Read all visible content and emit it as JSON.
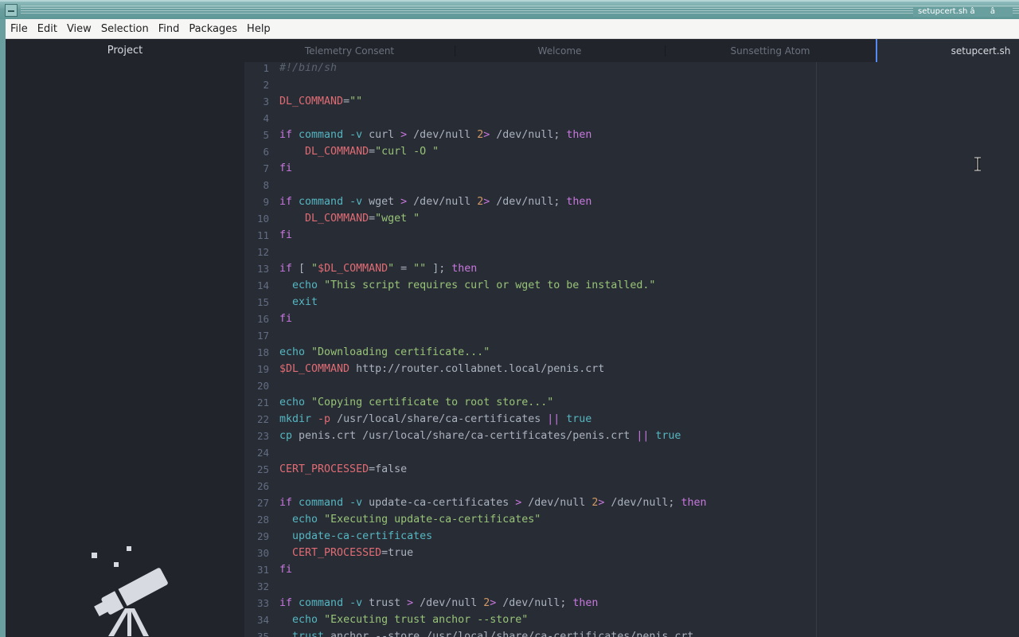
{
  "window": {
    "title": "setupcert.sh â â"
  },
  "menubar": [
    "File",
    "Edit",
    "View",
    "Selection",
    "Find",
    "Packages",
    "Help"
  ],
  "tree_view": {
    "header": "Project"
  },
  "tabs": [
    {
      "label": "Telemetry Consent",
      "active": false
    },
    {
      "label": "Welcome",
      "active": false
    },
    {
      "label": "Sunsetting Atom",
      "active": false
    },
    {
      "label": "setupcert.sh",
      "active": true
    }
  ],
  "editor": {
    "syntax_colors": {
      "comment": "#5c6370",
      "variable": "#e06c75",
      "string": "#98c379",
      "keyword": "#c678dd",
      "builtin": "#56b6c2",
      "constant": "#d19a66"
    },
    "lines": [
      [
        [
          "c-cmt",
          "#!/bin/sh"
        ]
      ],
      [],
      [
        [
          "c-var",
          "DL_COMMAND"
        ],
        [
          "",
          "="
        ],
        [
          "c-str",
          "\"\""
        ]
      ],
      [],
      [
        [
          "c-kw",
          "if"
        ],
        [
          "",
          " "
        ],
        [
          "c-fn",
          "command"
        ],
        [
          "",
          " "
        ],
        [
          "c-fn",
          "-v"
        ],
        [
          "",
          " curl "
        ],
        [
          "c-kw",
          ">"
        ],
        [
          "",
          " /dev/null "
        ],
        [
          "c-num",
          "2"
        ],
        [
          "c-kw",
          ">"
        ],
        [
          "",
          " /dev/null; "
        ],
        [
          "c-kw",
          "then"
        ]
      ],
      [
        [
          "",
          "    "
        ],
        [
          "c-var",
          "DL_COMMAND"
        ],
        [
          "",
          "="
        ],
        [
          "c-str",
          "\"curl -O \""
        ]
      ],
      [
        [
          "c-kw",
          "fi"
        ]
      ],
      [],
      [
        [
          "c-kw",
          "if"
        ],
        [
          "",
          " "
        ],
        [
          "c-fn",
          "command"
        ],
        [
          "",
          " "
        ],
        [
          "c-fn",
          "-v"
        ],
        [
          "",
          " wget "
        ],
        [
          "c-kw",
          ">"
        ],
        [
          "",
          " /dev/null "
        ],
        [
          "c-num",
          "2"
        ],
        [
          "c-kw",
          ">"
        ],
        [
          "",
          " /dev/null; "
        ],
        [
          "c-kw",
          "then"
        ]
      ],
      [
        [
          "",
          "    "
        ],
        [
          "c-var",
          "DL_COMMAND"
        ],
        [
          "",
          "="
        ],
        [
          "c-str",
          "\"wget \""
        ]
      ],
      [
        [
          "c-kw",
          "fi"
        ]
      ],
      [],
      [
        [
          "c-kw",
          "if"
        ],
        [
          "",
          " [ "
        ],
        [
          "c-str",
          "\""
        ],
        [
          "c-var",
          "$DL_COMMAND"
        ],
        [
          "c-str",
          "\""
        ],
        [
          "",
          " = "
        ],
        [
          "c-str",
          "\"\""
        ],
        [
          "",
          " ]; "
        ],
        [
          "c-kw",
          "then"
        ]
      ],
      [
        [
          "",
          "  "
        ],
        [
          "c-fn",
          "echo"
        ],
        [
          "",
          " "
        ],
        [
          "c-str",
          "\"This script requires curl or wget to be installed.\""
        ]
      ],
      [
        [
          "",
          "  "
        ],
        [
          "c-fn",
          "exit"
        ]
      ],
      [
        [
          "c-kw",
          "fi"
        ]
      ],
      [],
      [
        [
          "c-fn",
          "echo"
        ],
        [
          "",
          " "
        ],
        [
          "c-str",
          "\"Downloading certificate...\""
        ]
      ],
      [
        [
          "c-var",
          "$DL_COMMAND"
        ],
        [
          "",
          " http://router.collabnet.local/penis.crt"
        ]
      ],
      [],
      [
        [
          "c-fn",
          "echo"
        ],
        [
          "",
          " "
        ],
        [
          "c-str",
          "\"Copying certificate to root store...\""
        ]
      ],
      [
        [
          "c-fn",
          "mkdir"
        ],
        [
          "",
          " "
        ],
        [
          "c-var",
          "-p"
        ],
        [
          "",
          " /usr/local/share/ca-certificates "
        ],
        [
          "c-kw",
          "||"
        ],
        [
          "",
          " "
        ],
        [
          "c-fn",
          "true"
        ]
      ],
      [
        [
          "c-fn",
          "cp"
        ],
        [
          "",
          " penis.crt /usr/local/share/ca-certificates/penis.crt "
        ],
        [
          "c-kw",
          "||"
        ],
        [
          "",
          " "
        ],
        [
          "c-fn",
          "true"
        ]
      ],
      [],
      [
        [
          "c-var",
          "CERT_PROCESSED"
        ],
        [
          "",
          "=false"
        ]
      ],
      [],
      [
        [
          "c-kw",
          "if"
        ],
        [
          "",
          " "
        ],
        [
          "c-fn",
          "command"
        ],
        [
          "",
          " "
        ],
        [
          "c-fn",
          "-v"
        ],
        [
          "",
          " update-ca-certificates "
        ],
        [
          "c-kw",
          ">"
        ],
        [
          "",
          " /dev/null "
        ],
        [
          "c-num",
          "2"
        ],
        [
          "c-kw",
          ">"
        ],
        [
          "",
          " /dev/null; "
        ],
        [
          "c-kw",
          "then"
        ]
      ],
      [
        [
          "",
          "  "
        ],
        [
          "c-fn",
          "echo"
        ],
        [
          "",
          " "
        ],
        [
          "c-str",
          "\"Executing update-ca-certificates\""
        ]
      ],
      [
        [
          "",
          "  "
        ],
        [
          "c-fn",
          "update-ca-certificates"
        ]
      ],
      [
        [
          "",
          "  "
        ],
        [
          "c-var",
          "CERT_PROCESSED"
        ],
        [
          "",
          "=true"
        ]
      ],
      [
        [
          "c-kw",
          "fi"
        ]
      ],
      [],
      [
        [
          "c-kw",
          "if"
        ],
        [
          "",
          " "
        ],
        [
          "c-fn",
          "command"
        ],
        [
          "",
          " "
        ],
        [
          "c-fn",
          "-v"
        ],
        [
          "",
          " trust "
        ],
        [
          "c-kw",
          ">"
        ],
        [
          "",
          " /dev/null "
        ],
        [
          "c-num",
          "2"
        ],
        [
          "c-kw",
          ">"
        ],
        [
          "",
          " /dev/null; "
        ],
        [
          "c-kw",
          "then"
        ]
      ],
      [
        [
          "",
          "  "
        ],
        [
          "c-fn",
          "echo"
        ],
        [
          "",
          " "
        ],
        [
          "c-str",
          "\"Executing trust anchor --store\""
        ]
      ],
      [
        [
          "",
          "  "
        ],
        [
          "c-fn",
          "trust"
        ],
        [
          "",
          " anchor --store /usr/local/share/ca-certificates/penis.crt"
        ]
      ]
    ]
  }
}
